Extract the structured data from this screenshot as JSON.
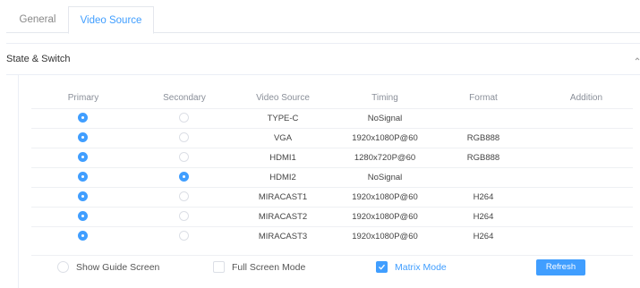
{
  "tabs": [
    {
      "label": "General",
      "active": false
    },
    {
      "label": "Video Source",
      "active": true
    }
  ],
  "section": {
    "title": "State & Switch",
    "toggle_icon": "chevron-up-icon"
  },
  "table": {
    "headers": [
      "Primary",
      "Secondary",
      "Video Source",
      "Timing",
      "Format",
      "Addition"
    ],
    "rows": [
      {
        "primary": true,
        "secondary": false,
        "source": "TYPE-C",
        "timing": "NoSignal",
        "format": "",
        "addition": ""
      },
      {
        "primary": true,
        "secondary": false,
        "source": "VGA",
        "timing": "1920x1080P@60",
        "format": "RGB888",
        "addition": ""
      },
      {
        "primary": true,
        "secondary": false,
        "source": "HDMI1",
        "timing": "1280x720P@60",
        "format": "RGB888",
        "addition": ""
      },
      {
        "primary": true,
        "secondary": true,
        "source": "HDMI2",
        "timing": "NoSignal",
        "format": "",
        "addition": ""
      },
      {
        "primary": true,
        "secondary": false,
        "source": "MIRACAST1",
        "timing": "1920x1080P@60",
        "format": "H264",
        "addition": ""
      },
      {
        "primary": true,
        "secondary": false,
        "source": "MIRACAST2",
        "timing": "1920x1080P@60",
        "format": "H264",
        "addition": ""
      },
      {
        "primary": true,
        "secondary": false,
        "source": "MIRACAST3",
        "timing": "1920x1080P@60",
        "format": "H264",
        "addition": ""
      }
    ]
  },
  "controls": {
    "show_guide_screen": {
      "label": "Show Guide Screen",
      "checked": false
    },
    "full_screen_mode": {
      "label": "Full Screen Mode",
      "checked": false
    },
    "matrix_mode": {
      "label": "Matrix Mode",
      "checked": true
    },
    "refresh_label": "Refresh"
  },
  "colors": {
    "accent": "#409eff",
    "border": "#dcdfe6"
  }
}
